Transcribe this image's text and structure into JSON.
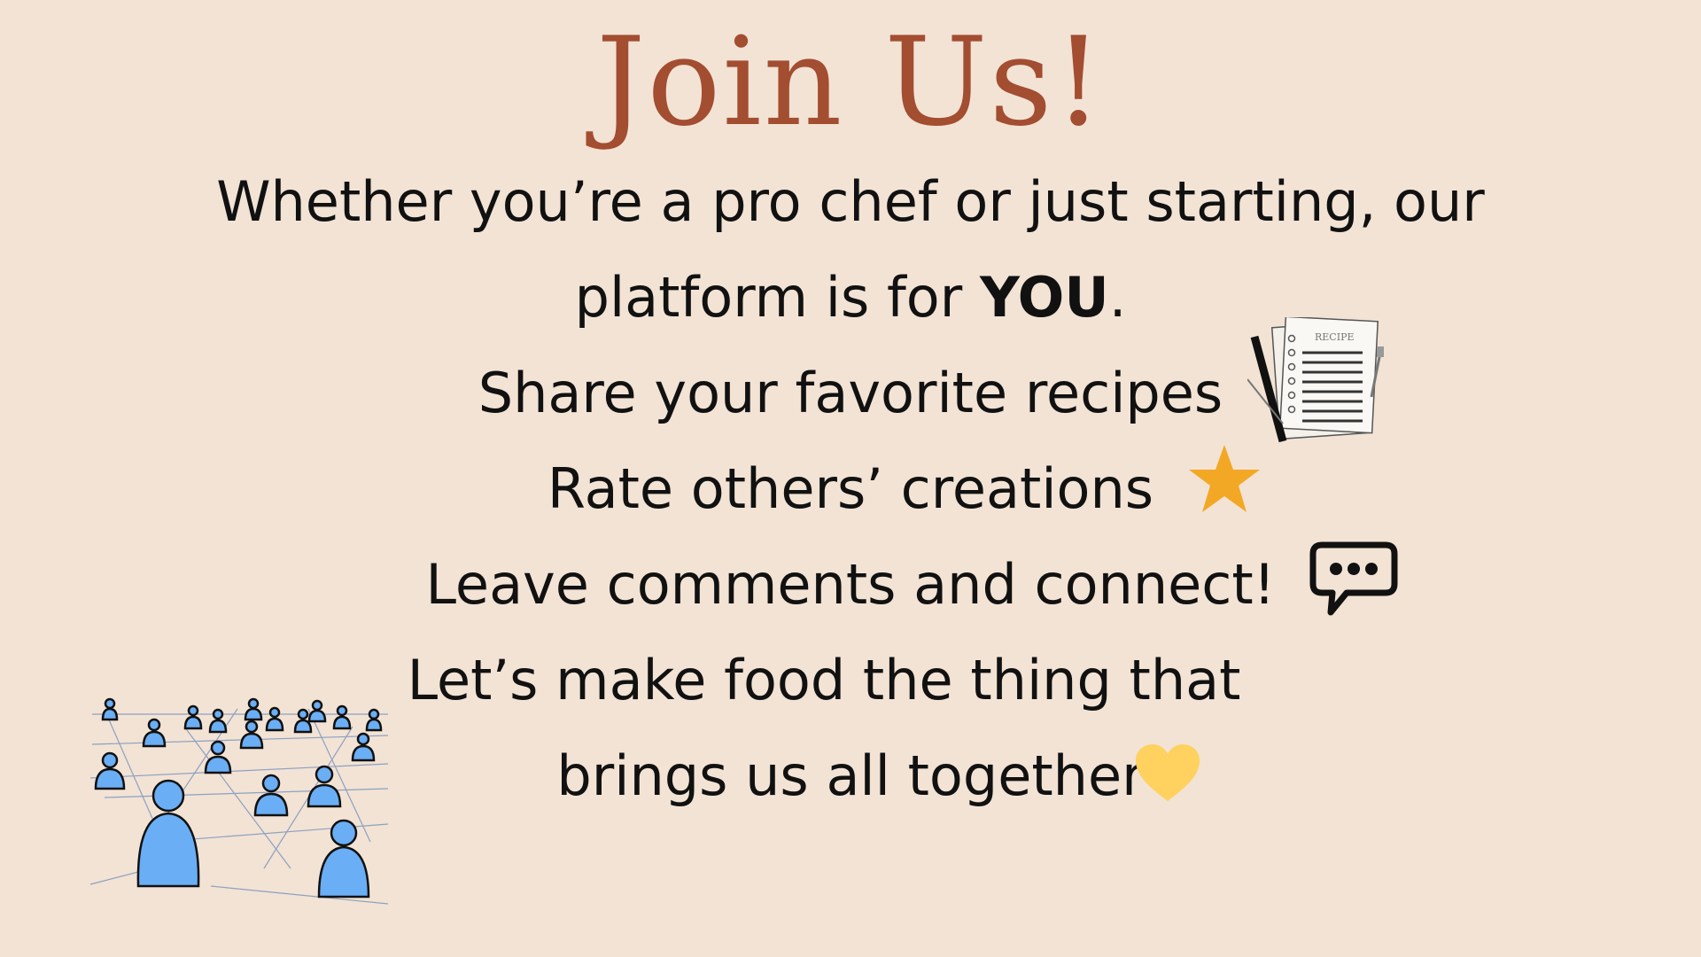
{
  "title": "Join Us!",
  "intro": {
    "line1": "Whether you’re a pro chef or just starting, our",
    "line2_pre": "platform is for ",
    "line2_bold": "YOU",
    "line2_post": "."
  },
  "features": {
    "share": "Share your favorite recipes",
    "rate": "Rate others’ creations",
    "comment": "Leave comments and connect!"
  },
  "closing": {
    "line1": "Let’s make food the thing that",
    "line2": "brings us all together"
  },
  "recipe_card": {
    "label": "RECIPE"
  },
  "icons": {
    "recipe": "recipe-card-icon",
    "star": "star-icon",
    "comment": "chat-bubble-icon",
    "heart": "heart-icon",
    "network": "people-network-illustration"
  },
  "colors": {
    "background": "#f2e3d5",
    "title": "#a34d31",
    "star": "#f2a824",
    "heart": "#ffd15e",
    "people": "#6aaef5"
  }
}
